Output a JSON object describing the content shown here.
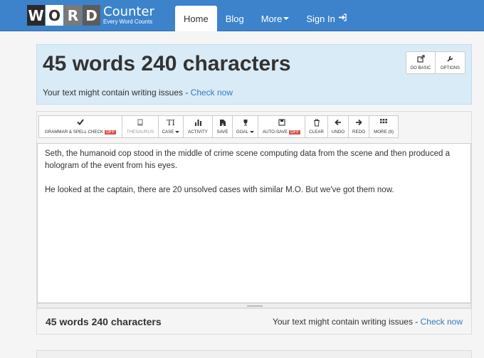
{
  "logo": {
    "letters": [
      "W",
      "O",
      "R",
      "D"
    ],
    "counter": "Counter",
    "tagline": "Every Word Counts"
  },
  "nav": {
    "home": "Home",
    "blog": "Blog",
    "more": "More",
    "signin": "Sign In"
  },
  "summary": {
    "title": "45 words 240 characters",
    "issues_text": "Your text might contain writing issues - ",
    "issues_link": "Check now",
    "go_basic": "GO BASIC",
    "options": "OPTIONS"
  },
  "toolbar": {
    "grammar": "GRAMMAR & SPELL CHECK",
    "grammar_badge": "OFF",
    "thesaurus": "THESAURUS",
    "case": "CASE",
    "activity": "ACTIVITY",
    "save": "SAVE",
    "goal": "GOAL",
    "autosave": "AUTO-SAVE",
    "autosave_badge": "OFF",
    "clear": "CLEAR",
    "undo": "UNDO",
    "redo": "REDO",
    "more": "MORE (9)"
  },
  "editor": {
    "paragraph1": "Seth, the humanoid cop stood in the middle of crime scene computing data from the scene and then produced a hologram of the event from his eyes.",
    "paragraph2": "He looked at the captain, there are 20 unsolved cases with similar M.O. But we've got them now."
  },
  "bottom": {
    "count": "45 words 240 characters",
    "issues_text": "Your text might contain writing issues - ",
    "issues_link": "Check now"
  },
  "icons": {
    "go_basic": "external-link-icon",
    "options": "wrench-icon",
    "grammar": "check-icon",
    "thesaurus": "book-icon",
    "case": "text-case-icon",
    "activity": "bar-chart-icon",
    "save": "save-file-icon",
    "goal": "trophy-icon",
    "autosave": "floppy-icon",
    "clear": "trash-icon",
    "undo": "arrow-left-icon",
    "redo": "arrow-right-icon",
    "more": "grid-icon",
    "signin": "sign-in-icon"
  },
  "colors": {
    "navbar": "#3c83cc",
    "summary_bg": "#d9ebf6",
    "link": "#2f7ec6",
    "off_badge": "#d9534f"
  }
}
